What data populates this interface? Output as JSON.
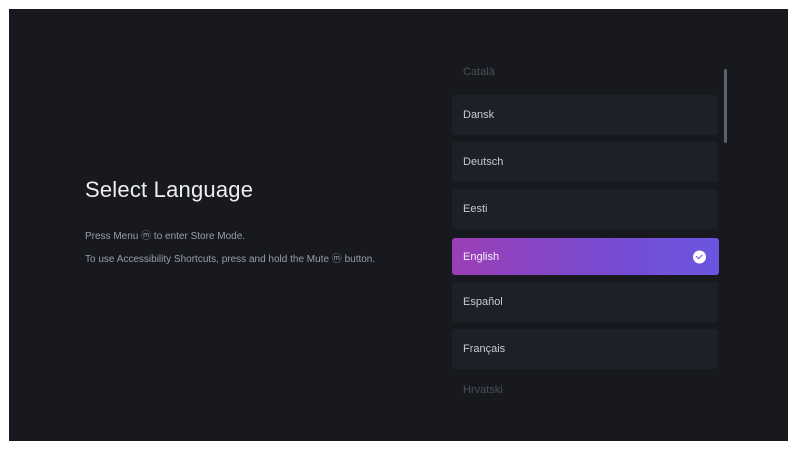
{
  "screen": {
    "title": "Select Language",
    "hint_menu": "Press Menu ⓜ to enter Store Mode.",
    "hint_accessibility": "To use Accessibility Shortcuts, press and hold the Mute ⓜ button."
  },
  "languages": {
    "items": [
      {
        "label": "Català"
      },
      {
        "label": "Dansk"
      },
      {
        "label": "Deutsch"
      },
      {
        "label": "Eesti"
      },
      {
        "label": "English"
      },
      {
        "label": "Español"
      },
      {
        "label": "Français"
      },
      {
        "label": "Hrvatski"
      }
    ],
    "selected": "English"
  },
  "colors": {
    "background": "#17191e",
    "item_bg": "#1d2027",
    "selected_gradient_start": "#9b3fb5",
    "selected_gradient_end": "#6a55e0"
  }
}
